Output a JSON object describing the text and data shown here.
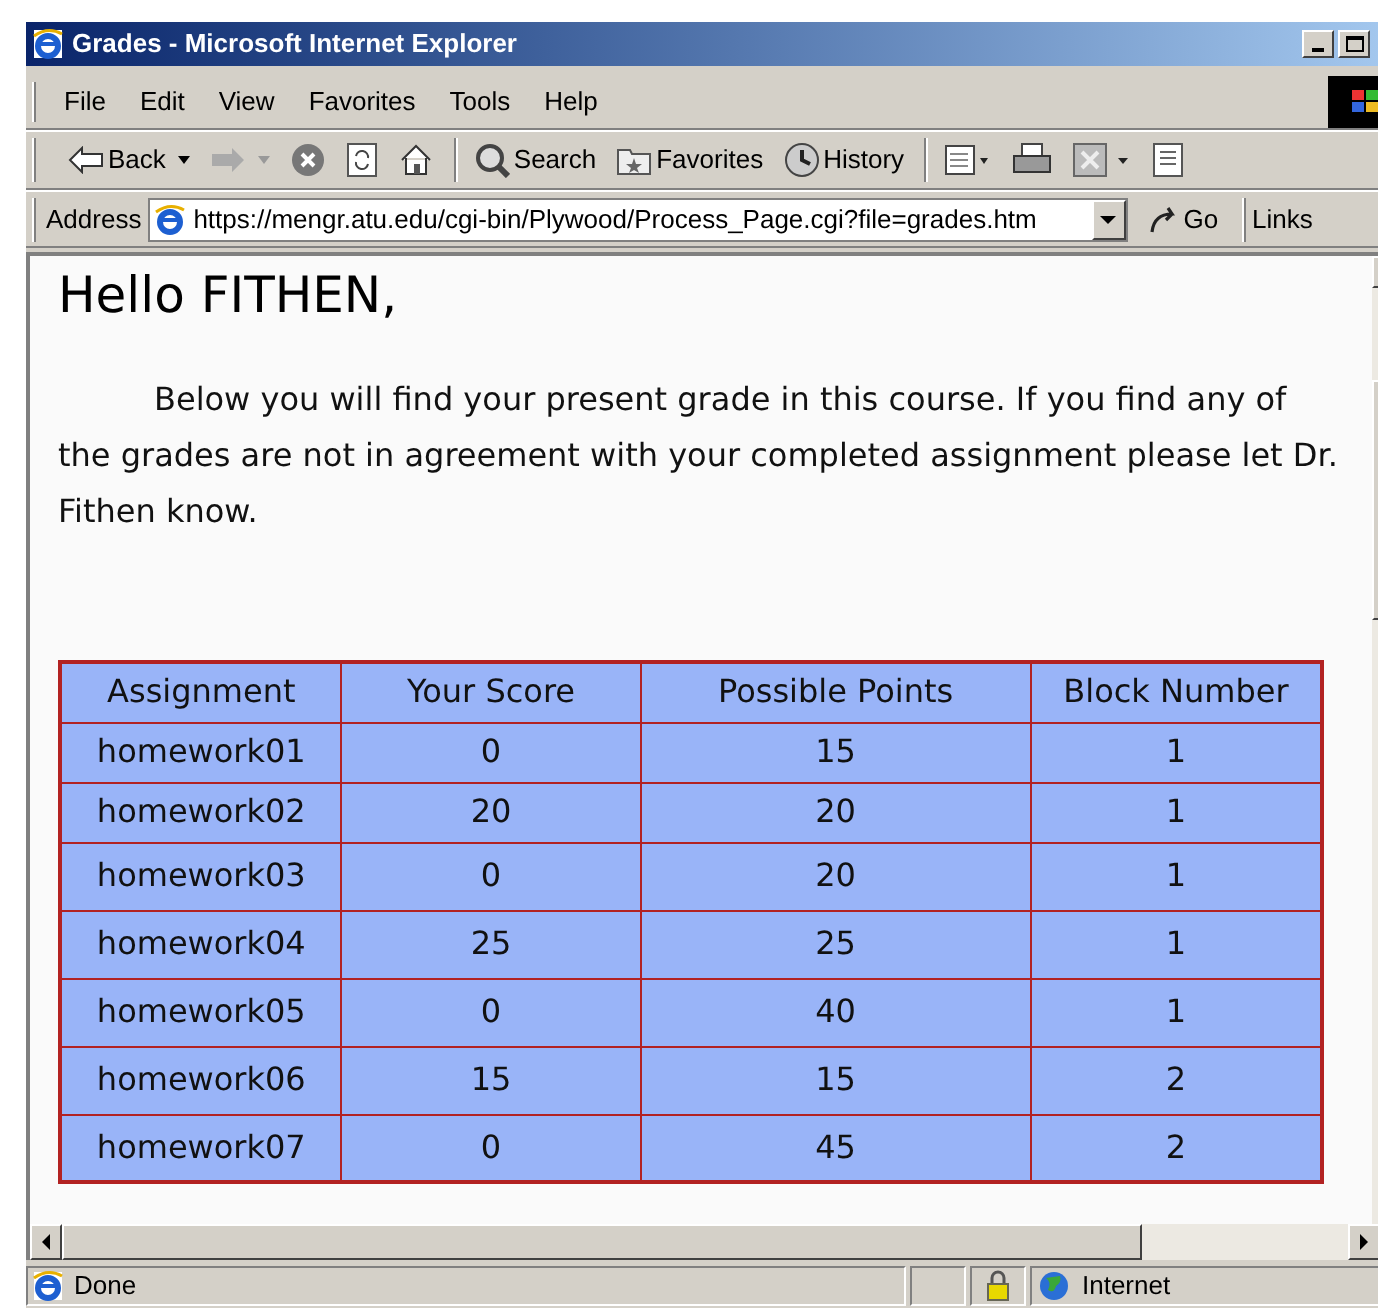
{
  "window": {
    "title": "Grades - Microsoft Internet Explorer"
  },
  "menu": [
    "File",
    "Edit",
    "View",
    "Favorites",
    "Tools",
    "Help"
  ],
  "toolbar": [
    {
      "kind": "back",
      "label": "Back"
    },
    {
      "kind": "forward"
    },
    {
      "kind": "stop"
    },
    {
      "kind": "refresh"
    },
    {
      "kind": "home"
    },
    {
      "kind": "search",
      "label": "Search"
    },
    {
      "kind": "favorites",
      "label": "Favorites"
    },
    {
      "kind": "history",
      "label": "History"
    },
    {
      "kind": "mail"
    },
    {
      "kind": "print"
    },
    {
      "kind": "edit"
    },
    {
      "kind": "discuss"
    }
  ],
  "address_bar": {
    "label": "Address",
    "value": "https://mengr.atu.edu/cgi-bin/Plywood/Process_Page.cgi?file=grades.htm",
    "go": "Go",
    "links": "Links"
  },
  "page": {
    "heading": "Hello FITHEN,",
    "paragraph": "Below you will find your present grade in this course. If you find any of the grades are not in agreement with your completed assignment please let Dr. Fithen know.",
    "table": {
      "columns": [
        "Assignment",
        "Your Score",
        "Possible Points",
        "Block Number"
      ],
      "rows": [
        [
          "homework01",
          "0",
          "15",
          "1"
        ],
        [
          "homework02",
          "20",
          "20",
          "1"
        ],
        [
          "homework03",
          "0",
          "20",
          "1"
        ],
        [
          "homework04",
          "25",
          "25",
          "1"
        ],
        [
          "homework05",
          "0",
          "40",
          "1"
        ],
        [
          "homework06",
          "15",
          "15",
          "2"
        ],
        [
          "homework07",
          "0",
          "45",
          "2"
        ]
      ]
    }
  },
  "status_bar": {
    "text": "Done",
    "zone": "Internet"
  }
}
